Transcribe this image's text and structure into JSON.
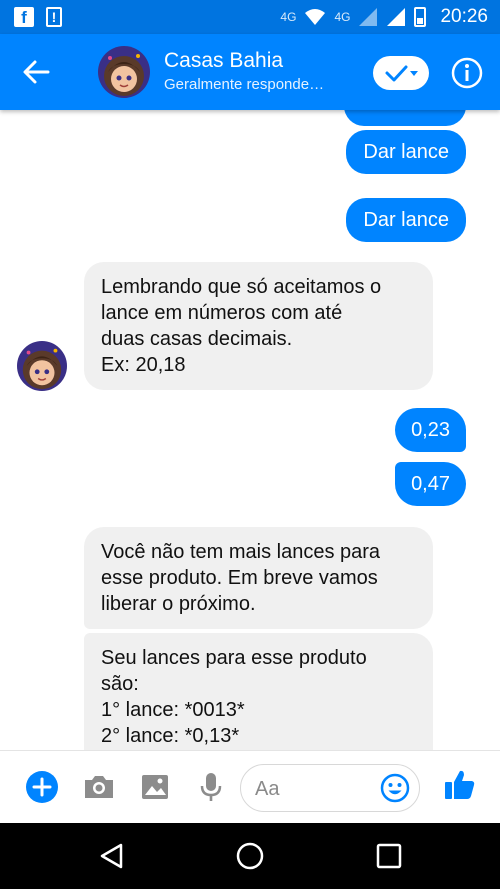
{
  "status_bar": {
    "time": "20:26",
    "network_left": "4G",
    "network_right": "4G",
    "icons": [
      "facebook-icon",
      "alert-icon",
      "wifi-icon",
      "signal-icon",
      "battery-icon"
    ]
  },
  "header": {
    "title": "Casas Bahia",
    "subtitle": "Geralmente responde…",
    "colors": {
      "bar": "#0084ff",
      "status": "#0074e0"
    }
  },
  "messages": [
    {
      "side": "outgoing",
      "text": "Dar lance"
    },
    {
      "side": "outgoing",
      "text": "Dar lance"
    },
    {
      "side": "incoming",
      "text": "Lembrando que só aceitamos o\nlance em números com até\nduas casas decimais.\nEx: 20,18"
    },
    {
      "side": "outgoing",
      "text": "0,23"
    },
    {
      "side": "outgoing",
      "text": "0,47"
    },
    {
      "side": "incoming",
      "text": "Você não tem mais lances para\nesse produto. Em breve vamos\nliberar o próximo."
    },
    {
      "side": "incoming",
      "text": "Seu lances para esse produto\nsão:\n1° lance: *0013*\n2° lance: *0,13*"
    }
  ],
  "composer": {
    "placeholder": "Aa",
    "icons": [
      "add-icon",
      "camera-icon",
      "gallery-icon",
      "microphone-icon",
      "emoji-icon",
      "thumbs-up-icon"
    ]
  },
  "nav_bar": {
    "icons": [
      "back-icon",
      "home-icon",
      "recents-icon"
    ]
  }
}
